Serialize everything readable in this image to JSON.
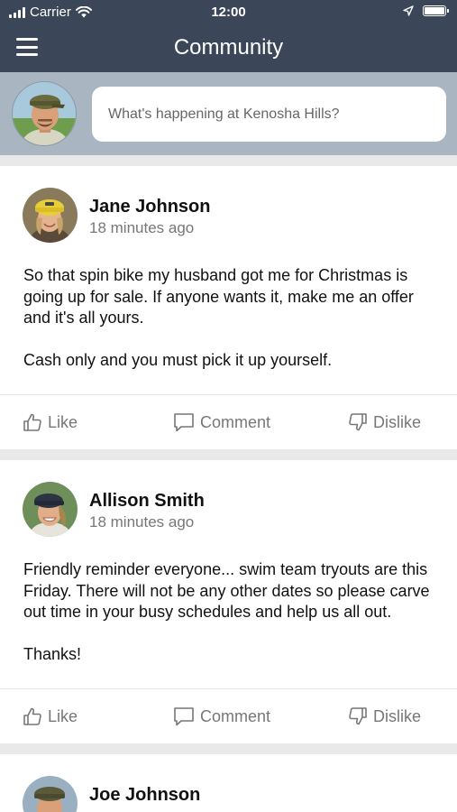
{
  "status_bar": {
    "carrier": "Carrier",
    "time": "12:00",
    "icons": [
      "signal-bars-icon",
      "wifi-icon",
      "location-arrow-icon",
      "battery-icon"
    ]
  },
  "nav": {
    "title": "Community",
    "menu_icon": "hamburger-menu-icon"
  },
  "composer": {
    "placeholder": "What's happening at Kenosha Hills?"
  },
  "actions": {
    "like": "Like",
    "comment": "Comment",
    "dislike": "Dislike"
  },
  "posts": [
    {
      "author": "Jane Johnson",
      "time": "18 minutes ago",
      "paragraphs": [
        "So that spin bike my husband got me for Christmas is going up for sale. If anyone wants it, make me an offer and it's all yours.",
        "Cash only and you must pick it up yourself."
      ]
    },
    {
      "author": "Allison Smith",
      "time": "18 minutes ago",
      "paragraphs": [
        "Friendly reminder everyone... swim team tryouts are this Friday. There will not be any other dates so please carve out time in your busy schedules and help us all out.",
        "Thanks!"
      ]
    },
    {
      "author": "Joe Johnson"
    }
  ],
  "colors": {
    "nav_background": "#3b4659",
    "composer_background": "#a9b6c1",
    "feed_background": "#e9e9e9",
    "muted_text": "#777777"
  }
}
